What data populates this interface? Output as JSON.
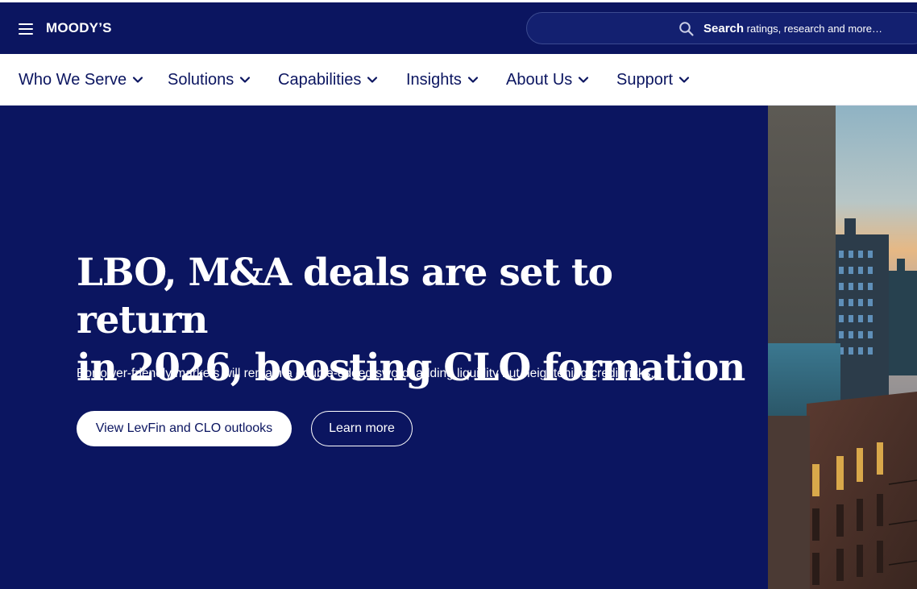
{
  "brand": {
    "logo_text": "MOODY’S",
    "primary_color": "#0b1560"
  },
  "header": {
    "menu_icon": "hamburger-icon",
    "search": {
      "icon": "search-icon",
      "bold": "Search",
      "rest": " ratings, research and more…"
    }
  },
  "nav": {
    "items": [
      {
        "label": "Who We Serve"
      },
      {
        "label": "Solutions"
      },
      {
        "label": "Capabilities"
      },
      {
        "label": "Insights"
      },
      {
        "label": "About Us"
      },
      {
        "label": "Support"
      }
    ],
    "chevron_icon": "chevron-down-icon"
  },
  "hero": {
    "title_line1": "LBO, M&A deals are set to return",
    "title_line2": "in 2026, boosting CLO formation",
    "subtitle": "Borrower-friendly markets will remain a double-edged sword, adding liquidity but heightening credit risks.",
    "primary_button": "View LevFin and CLO outlooks",
    "secondary_button": "Learn more",
    "image": "city-buildings-photo"
  }
}
